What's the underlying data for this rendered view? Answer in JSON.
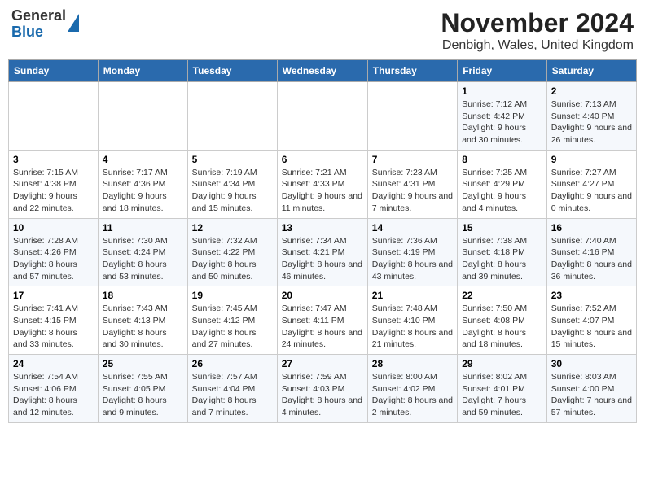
{
  "header": {
    "logo": {
      "line1": "General",
      "line2": "Blue"
    },
    "title": "November 2024",
    "subtitle": "Denbigh, Wales, United Kingdom"
  },
  "weekdays": [
    "Sunday",
    "Monday",
    "Tuesday",
    "Wednesday",
    "Thursday",
    "Friday",
    "Saturday"
  ],
  "weeks": [
    [
      {
        "day": "",
        "info": ""
      },
      {
        "day": "",
        "info": ""
      },
      {
        "day": "",
        "info": ""
      },
      {
        "day": "",
        "info": ""
      },
      {
        "day": "",
        "info": ""
      },
      {
        "day": "1",
        "info": "Sunrise: 7:12 AM\nSunset: 4:42 PM\nDaylight: 9 hours and 30 minutes."
      },
      {
        "day": "2",
        "info": "Sunrise: 7:13 AM\nSunset: 4:40 PM\nDaylight: 9 hours and 26 minutes."
      }
    ],
    [
      {
        "day": "3",
        "info": "Sunrise: 7:15 AM\nSunset: 4:38 PM\nDaylight: 9 hours and 22 minutes."
      },
      {
        "day": "4",
        "info": "Sunrise: 7:17 AM\nSunset: 4:36 PM\nDaylight: 9 hours and 18 minutes."
      },
      {
        "day": "5",
        "info": "Sunrise: 7:19 AM\nSunset: 4:34 PM\nDaylight: 9 hours and 15 minutes."
      },
      {
        "day": "6",
        "info": "Sunrise: 7:21 AM\nSunset: 4:33 PM\nDaylight: 9 hours and 11 minutes."
      },
      {
        "day": "7",
        "info": "Sunrise: 7:23 AM\nSunset: 4:31 PM\nDaylight: 9 hours and 7 minutes."
      },
      {
        "day": "8",
        "info": "Sunrise: 7:25 AM\nSunset: 4:29 PM\nDaylight: 9 hours and 4 minutes."
      },
      {
        "day": "9",
        "info": "Sunrise: 7:27 AM\nSunset: 4:27 PM\nDaylight: 9 hours and 0 minutes."
      }
    ],
    [
      {
        "day": "10",
        "info": "Sunrise: 7:28 AM\nSunset: 4:26 PM\nDaylight: 8 hours and 57 minutes."
      },
      {
        "day": "11",
        "info": "Sunrise: 7:30 AM\nSunset: 4:24 PM\nDaylight: 8 hours and 53 minutes."
      },
      {
        "day": "12",
        "info": "Sunrise: 7:32 AM\nSunset: 4:22 PM\nDaylight: 8 hours and 50 minutes."
      },
      {
        "day": "13",
        "info": "Sunrise: 7:34 AM\nSunset: 4:21 PM\nDaylight: 8 hours and 46 minutes."
      },
      {
        "day": "14",
        "info": "Sunrise: 7:36 AM\nSunset: 4:19 PM\nDaylight: 8 hours and 43 minutes."
      },
      {
        "day": "15",
        "info": "Sunrise: 7:38 AM\nSunset: 4:18 PM\nDaylight: 8 hours and 39 minutes."
      },
      {
        "day": "16",
        "info": "Sunrise: 7:40 AM\nSunset: 4:16 PM\nDaylight: 8 hours and 36 minutes."
      }
    ],
    [
      {
        "day": "17",
        "info": "Sunrise: 7:41 AM\nSunset: 4:15 PM\nDaylight: 8 hours and 33 minutes."
      },
      {
        "day": "18",
        "info": "Sunrise: 7:43 AM\nSunset: 4:13 PM\nDaylight: 8 hours and 30 minutes."
      },
      {
        "day": "19",
        "info": "Sunrise: 7:45 AM\nSunset: 4:12 PM\nDaylight: 8 hours and 27 minutes."
      },
      {
        "day": "20",
        "info": "Sunrise: 7:47 AM\nSunset: 4:11 PM\nDaylight: 8 hours and 24 minutes."
      },
      {
        "day": "21",
        "info": "Sunrise: 7:48 AM\nSunset: 4:10 PM\nDaylight: 8 hours and 21 minutes."
      },
      {
        "day": "22",
        "info": "Sunrise: 7:50 AM\nSunset: 4:08 PM\nDaylight: 8 hours and 18 minutes."
      },
      {
        "day": "23",
        "info": "Sunrise: 7:52 AM\nSunset: 4:07 PM\nDaylight: 8 hours and 15 minutes."
      }
    ],
    [
      {
        "day": "24",
        "info": "Sunrise: 7:54 AM\nSunset: 4:06 PM\nDaylight: 8 hours and 12 minutes."
      },
      {
        "day": "25",
        "info": "Sunrise: 7:55 AM\nSunset: 4:05 PM\nDaylight: 8 hours and 9 minutes."
      },
      {
        "day": "26",
        "info": "Sunrise: 7:57 AM\nSunset: 4:04 PM\nDaylight: 8 hours and 7 minutes."
      },
      {
        "day": "27",
        "info": "Sunrise: 7:59 AM\nSunset: 4:03 PM\nDaylight: 8 hours and 4 minutes."
      },
      {
        "day": "28",
        "info": "Sunrise: 8:00 AM\nSunset: 4:02 PM\nDaylight: 8 hours and 2 minutes."
      },
      {
        "day": "29",
        "info": "Sunrise: 8:02 AM\nSunset: 4:01 PM\nDaylight: 7 hours and 59 minutes."
      },
      {
        "day": "30",
        "info": "Sunrise: 8:03 AM\nSunset: 4:00 PM\nDaylight: 7 hours and 57 minutes."
      }
    ]
  ]
}
